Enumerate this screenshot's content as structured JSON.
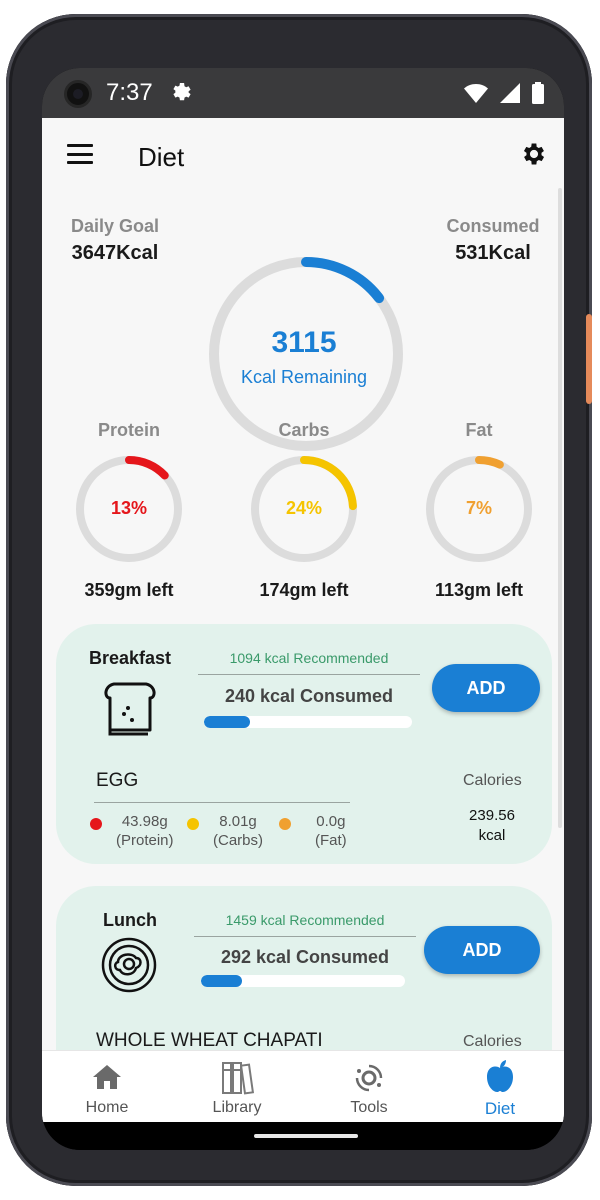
{
  "status_bar": {
    "time": "7:37"
  },
  "header": {
    "title": "Diet"
  },
  "summary": {
    "daily_goal_label": "Daily Goal",
    "daily_goal_value": "3647Kcal",
    "consumed_label": "Consumed",
    "consumed_value": "531Kcal",
    "remaining_value": "3115",
    "remaining_label": "Kcal Remaining",
    "remaining_ring_fraction": 0.146,
    "ring_color": "#1a7fd4"
  },
  "macros": [
    {
      "name": "Protein",
      "percent": "13%",
      "fraction": 0.13,
      "left": "359gm left",
      "color": "#e5161b"
    },
    {
      "name": "Carbs",
      "percent": "24%",
      "fraction": 0.24,
      "left": "174gm left",
      "color": "#f5c400"
    },
    {
      "name": "Fat",
      "percent": "7%",
      "fraction": 0.07,
      "left": "113gm left",
      "color": "#f0a030"
    }
  ],
  "meals": [
    {
      "name": "Breakfast",
      "icon": "toast-icon",
      "recommended": "1094 kcal Recommended",
      "consumed": "240 kcal Consumed",
      "progress_fraction": 0.22,
      "add_label": "ADD",
      "food": {
        "name": "EGG",
        "calories_label": "Calories",
        "calories_value": "239.56",
        "calories_unit": "kcal",
        "protein_value": "43.98g",
        "protein_label": "(Protein)",
        "carbs_value": "8.01g",
        "carbs_label": "(Carbs)",
        "fat_value": "0.0g",
        "fat_label": "(Fat)"
      }
    },
    {
      "name": "Lunch",
      "icon": "plate-icon",
      "recommended": "1459 kcal Recommended",
      "consumed": "292 kcal Consumed",
      "progress_fraction": 0.2,
      "add_label": "ADD",
      "food": {
        "name": "WHOLE WHEAT CHAPATI",
        "calories_label": "Calories"
      }
    }
  ],
  "nav": [
    {
      "label": "Home",
      "icon": "home-icon"
    },
    {
      "label": "Library",
      "icon": "library-icon"
    },
    {
      "label": "Tools",
      "icon": "tools-icon"
    },
    {
      "label": "Diet",
      "icon": "apple-icon",
      "active": true
    }
  ],
  "colors": {
    "accent": "#1a7fd4",
    "card_bg": "#e2f2ec",
    "recommended_text": "#3a9a6a"
  }
}
